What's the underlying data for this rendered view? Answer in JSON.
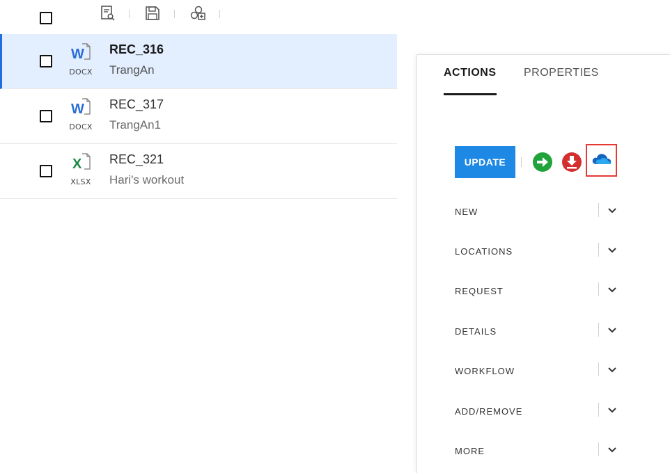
{
  "toolbar": {
    "icons": [
      "document-search-icon",
      "save-icon",
      "link-objects-icon"
    ]
  },
  "files": [
    {
      "name": "REC_316",
      "subtitle": "TrangAn",
      "ext": "DOCX",
      "type": "word",
      "selected": true
    },
    {
      "name": "REC_317",
      "subtitle": "TrangAn1",
      "ext": "DOCX",
      "type": "word",
      "selected": false
    },
    {
      "name": "REC_321",
      "subtitle": "Hari's workout",
      "ext": "XLSX",
      "type": "excel",
      "selected": false
    }
  ],
  "panel": {
    "tabs": {
      "actions": "ACTIONS",
      "properties": "PROPERTIES"
    },
    "update_label": "UPDATE",
    "action_icons": [
      "forward-arrow-icon",
      "download-icon",
      "onedrive-cloud-icon"
    ],
    "sections": [
      "NEW",
      "LOCATIONS",
      "REQUEST",
      "DETAILS",
      "WORKFLOW",
      "ADD/REMOVE",
      "MORE"
    ]
  },
  "colors": {
    "accent": "#1e88e5",
    "selected_row_bg": "#e3efff",
    "selected_row_bar": "#1f6fe0",
    "word_blue": "#2b6cd6",
    "excel_green": "#1e8a45",
    "forward_green": "#1fa33a",
    "download_red": "#d32f2f",
    "highlight_box": "#e53935"
  }
}
